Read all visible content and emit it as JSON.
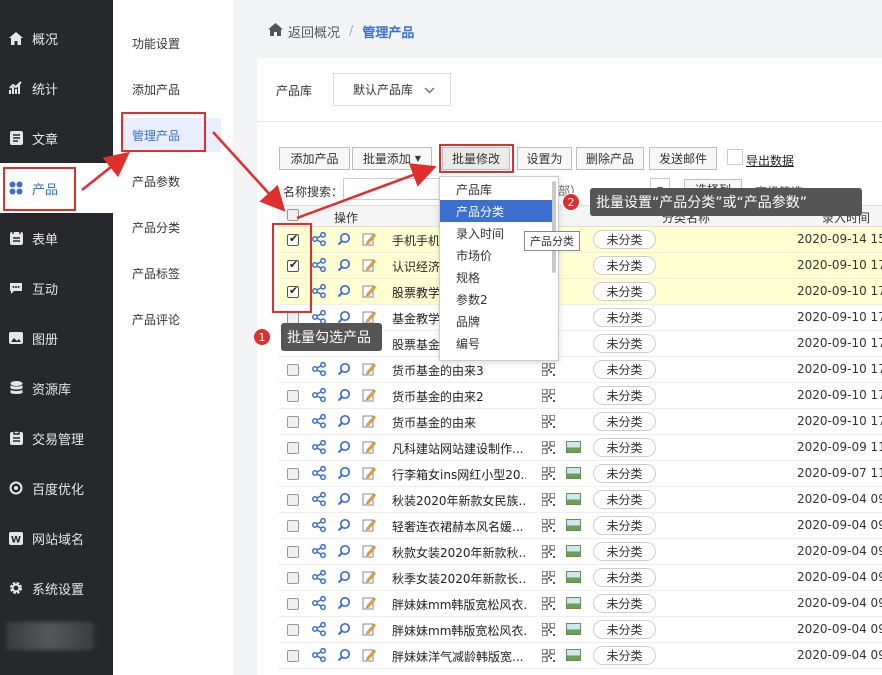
{
  "sidebar": {
    "items": [
      {
        "label": "概况",
        "icon": "home-icon"
      },
      {
        "label": "统计",
        "icon": "chart-icon"
      },
      {
        "label": "文章",
        "icon": "article-icon"
      },
      {
        "label": "产品",
        "icon": "product-icon"
      },
      {
        "label": "表单",
        "icon": "form-icon"
      },
      {
        "label": "互动",
        "icon": "chat-icon"
      },
      {
        "label": "图册",
        "icon": "album-icon"
      },
      {
        "label": "资源库",
        "icon": "database-icon"
      },
      {
        "label": "交易管理",
        "icon": "trade-icon"
      },
      {
        "label": "百度优化",
        "icon": "seo-icon"
      },
      {
        "label": "网站域名",
        "icon": "domain-icon"
      },
      {
        "label": "系统设置",
        "icon": "gear-icon"
      }
    ]
  },
  "submenu": {
    "items": [
      "功能设置",
      "添加产品",
      "管理产品",
      "产品参数",
      "产品分类",
      "产品标签",
      "产品评论"
    ]
  },
  "breadcrumb": {
    "back": "返回概况",
    "sep": "/",
    "current": "管理产品"
  },
  "filter": {
    "label": "产品库",
    "select": "默认产品库"
  },
  "toolbar": {
    "add": "添加产品",
    "batch_add": "批量添加",
    "batch_edit": "批量修改",
    "set_as": "设置为",
    "delete": "删除产品",
    "send_mail": "发送邮件",
    "export": "导出数据"
  },
  "search": {
    "label": "名称搜索：",
    "cat_partial": "部）",
    "col_btn": "选择列",
    "adv": "高级筛选"
  },
  "table": {
    "headers": {
      "ops": "操作",
      "cat": "分类名称",
      "time": "录入时间"
    },
    "rows": [
      {
        "checked": true,
        "name": "手机手机",
        "img": false,
        "cat": "未分类",
        "time": "2020-09-14 15"
      },
      {
        "checked": true,
        "name": "认识经济",
        "img": false,
        "cat": "未分类",
        "time": "2020-09-10 17"
      },
      {
        "checked": true,
        "name": "股票教学",
        "img": false,
        "cat": "未分类",
        "time": "2020-09-10 17"
      },
      {
        "checked": false,
        "name": "基金教学",
        "img": false,
        "cat": "未分类",
        "time": "2020-09-10 17"
      },
      {
        "checked": false,
        "name": "股票基金",
        "img": false,
        "cat": "未分类",
        "time": "2020-09-10 17"
      },
      {
        "checked": false,
        "name": "货币基金的由来3",
        "img": false,
        "cat": "未分类",
        "time": "2020-09-10 17"
      },
      {
        "checked": false,
        "name": "货币基金的由来2",
        "img": false,
        "cat": "未分类",
        "time": "2020-09-10 17"
      },
      {
        "checked": false,
        "name": "货币基金的由来",
        "img": false,
        "cat": "未分类",
        "time": "2020-09-10 17"
      },
      {
        "checked": false,
        "name": "凡科建站网站建设制作...",
        "img": true,
        "cat": "未分类",
        "time": "2020-09-09 11"
      },
      {
        "checked": false,
        "name": "行李箱女ins网红小型20...",
        "img": true,
        "cat": "未分类",
        "time": "2020-09-07 11"
      },
      {
        "checked": false,
        "name": "秋装2020年新款女民族...",
        "img": true,
        "cat": "未分类",
        "time": "2020-09-04 09"
      },
      {
        "checked": false,
        "name": "轻奢连衣裙赫本风名媛...",
        "img": true,
        "cat": "未分类",
        "time": "2020-09-04 09"
      },
      {
        "checked": false,
        "name": "秋款女装2020年新款秋...",
        "img": true,
        "cat": "未分类",
        "time": "2020-09-04 09"
      },
      {
        "checked": false,
        "name": "秋季女装2020年新款长...",
        "img": true,
        "cat": "未分类",
        "time": "2020-09-04 09"
      },
      {
        "checked": false,
        "name": "胖妹妹mm韩版宽松风衣...",
        "img": true,
        "cat": "未分类",
        "time": "2020-09-04 09"
      },
      {
        "checked": false,
        "name": "胖妹妹mm韩版宽松风衣...",
        "img": true,
        "cat": "未分类",
        "time": "2020-09-04 09"
      },
      {
        "checked": false,
        "name": "胖妹妹洋气减龄韩版宽...",
        "img": true,
        "cat": "未分类",
        "time": "2020-09-04 09"
      }
    ]
  },
  "dropdown": {
    "items": [
      "产品库",
      "产品分类",
      "录入时间",
      "市场价",
      "规格",
      "参数2",
      "品牌",
      "编号"
    ],
    "tooltip": "产品分类"
  },
  "annotations": {
    "one": "1",
    "one_text": "批量勾选产品",
    "two": "2",
    "two_text": "批量设置“产品分类”或“产品参数”"
  },
  "colors": {
    "accent": "#3b6fd0",
    "highlight": "#e02d2d",
    "sidebar": "#26282b",
    "selected_row": "#ffffd2"
  }
}
